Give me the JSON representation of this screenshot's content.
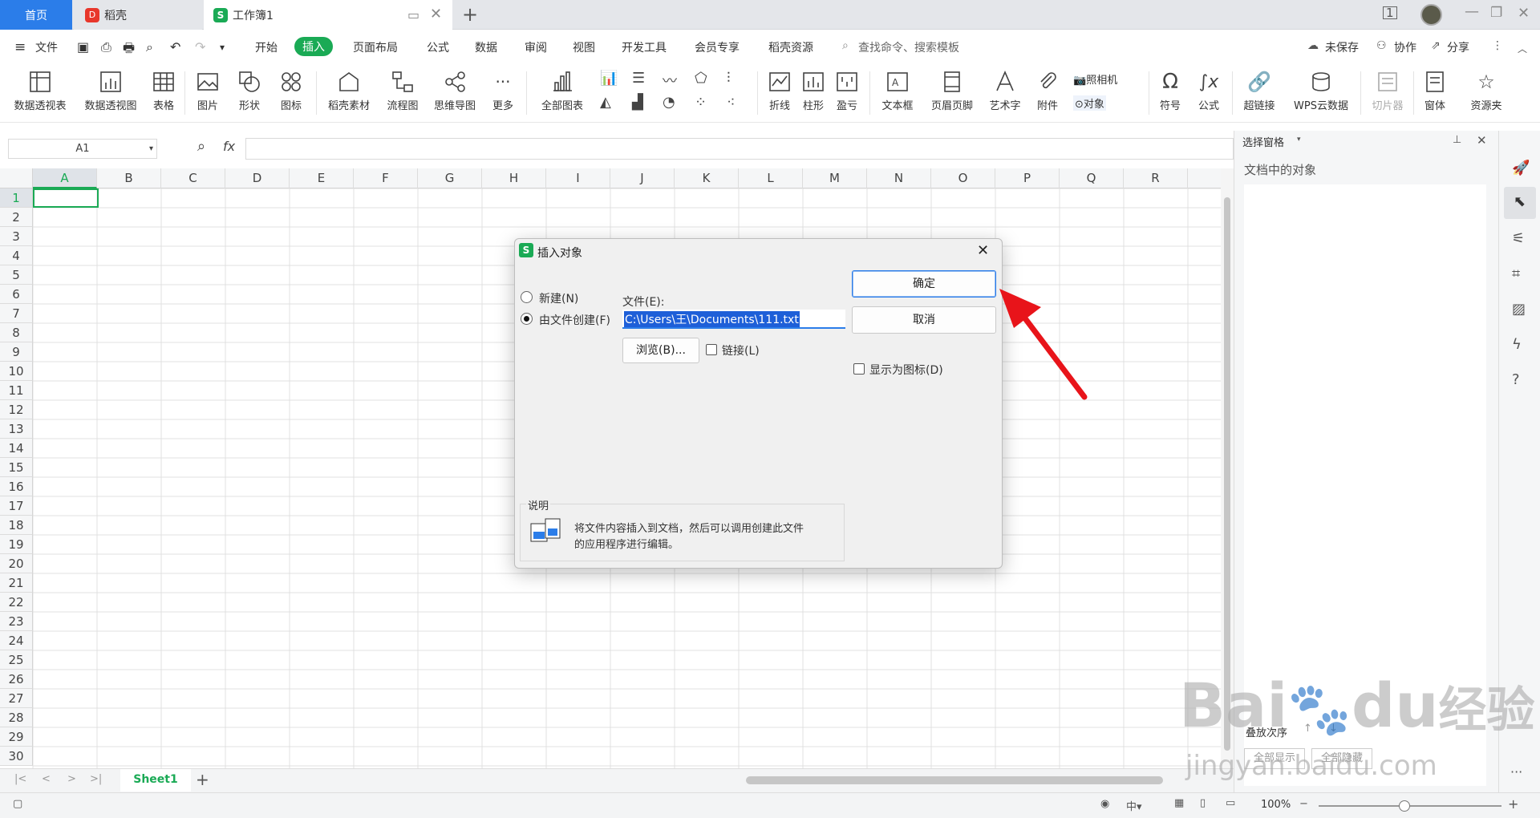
{
  "tabs": {
    "home": "首页",
    "daoke": "稻壳",
    "book": "工作簿1",
    "daoke_logo": "D",
    "book_logo": "S"
  },
  "menu": {
    "file": "文件",
    "items": [
      "开始",
      "插入",
      "页面布局",
      "公式",
      "数据",
      "审阅",
      "视图",
      "开发工具",
      "会员专享",
      "稻壳资源"
    ],
    "active": "插入",
    "search": "查找命令、搜索模板",
    "unsaved": "未保存",
    "collab": "协作",
    "share": "分享"
  },
  "ribbon": {
    "pivot_table": "数据透视表",
    "pivot_view": "数据透视图",
    "table": "表格",
    "picture": "图片",
    "shape": "形状",
    "icon": "图标",
    "daoke_material": "稻壳素材",
    "flowchart": "流程图",
    "mindmap": "思维导图",
    "more": "更多",
    "all_charts": "全部图表",
    "line": "折线",
    "column": "柱形",
    "winloss": "盈亏",
    "textbox": "文本框",
    "header_footer": "页眉页脚",
    "wordart": "艺术字",
    "attachment": "附件",
    "camera": "照相机",
    "object": "对象",
    "symbol": "符号",
    "formula": "公式",
    "hyperlink": "超链接",
    "wps_cloud": "WPS云数据",
    "slicer": "切片器",
    "window": "窗体",
    "resources": "资源夹"
  },
  "formula_bar": {
    "name_box": "A1",
    "fx": "fx"
  },
  "grid": {
    "columns": [
      "A",
      "B",
      "C",
      "D",
      "E",
      "F",
      "G",
      "H",
      "I",
      "J",
      "K",
      "L",
      "M",
      "N",
      "O",
      "P",
      "Q",
      "R"
    ],
    "rows": [
      "1",
      "2",
      "3",
      "4",
      "5",
      "6",
      "7",
      "8",
      "9",
      "10",
      "11",
      "12",
      "13",
      "14",
      "15",
      "16",
      "17",
      "18",
      "19",
      "20",
      "21",
      "22",
      "23",
      "24",
      "25",
      "26",
      "27",
      "28",
      "29",
      "30"
    ]
  },
  "sheets": [
    "Sheet1"
  ],
  "status": {
    "zoom": "100%"
  },
  "panel": {
    "title": "选择窗格",
    "subtitle": "文档中的对象",
    "sort_label": "叠放次序",
    "show_all": "全部显示",
    "hide_all": "全部隐藏"
  },
  "dialog": {
    "title": "插入对象",
    "title_logo": "S",
    "new_label": "新建(N)",
    "from_file_label": "由文件创建(F)",
    "file_label": "文件(E):",
    "file_value": "C:\\Users\\王\\Documents\\111.txt",
    "browse": "浏览(B)...",
    "link": "链接(L)",
    "ok": "确定",
    "cancel": "取消",
    "display_icon": "显示为图标(D)",
    "desc_title": "说明",
    "desc_line1": "将文件内容插入到文档，然后可以调用创建此文件",
    "desc_line2": "的应用程序进行编辑。"
  },
  "watermark": {
    "brand": "Bai",
    "brand2": "du",
    "brand_cn": "经验",
    "url": "jingyan.baidu.com"
  }
}
